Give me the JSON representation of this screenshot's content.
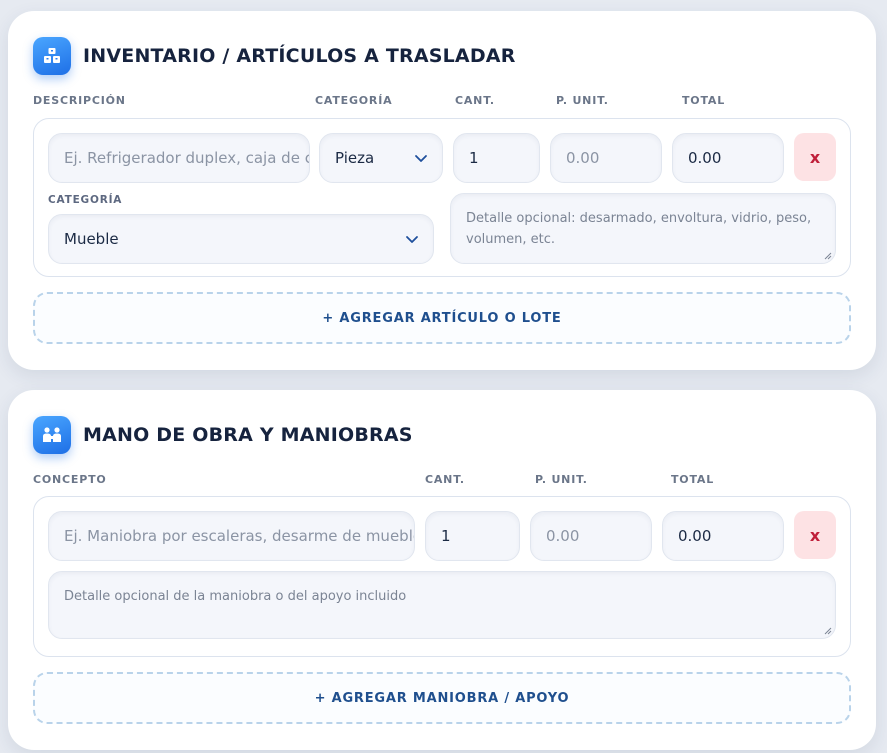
{
  "inventory": {
    "title": "INVENTARIO / ARTÍCULOS A TRASLADAR",
    "icon": "boxes-icon",
    "columns": {
      "description": "DESCRIPCIÓN",
      "category": "CATEGORÍA",
      "qty": "CANT.",
      "unit_price": "P. UNIT.",
      "total": "TOTAL"
    },
    "row": {
      "description_placeholder": "Ej. Refrigerador duplex, caja de c",
      "category_value": "Pieza",
      "qty_value": "1",
      "unit_price_placeholder": "0.00",
      "total_value": "0.00",
      "remove_label": "x",
      "sub_category_label": "CATEGORÍA",
      "sub_category_value": "Mueble",
      "detail_placeholder": "Detalle opcional: desarmado, envoltura, vidrio, peso, volumen, etc."
    },
    "add_button": "+ AGREGAR ARTÍCULO O LOTE"
  },
  "labor": {
    "title": "MANO DE OBRA Y MANIOBRAS",
    "icon": "people-icon",
    "columns": {
      "concept": "CONCEPTO",
      "qty": "CANT.",
      "unit_price": "P. UNIT.",
      "total": "TOTAL"
    },
    "row": {
      "concept_placeholder": "Ej. Maniobra por escaleras, desarme de mueble",
      "qty_value": "1",
      "unit_price_placeholder": "0.00",
      "total_value": "0.00",
      "remove_label": "x",
      "detail_placeholder": "Detalle opcional de la maniobra o del apoyo incluido"
    },
    "add_button": "+ AGREGAR MANIOBRA / APOYO"
  },
  "colors": {
    "accent": "#1e6fe6",
    "remove_bg": "#fde2e4",
    "remove_fg": "#c01f3a",
    "add_text": "#1f4f8e"
  }
}
